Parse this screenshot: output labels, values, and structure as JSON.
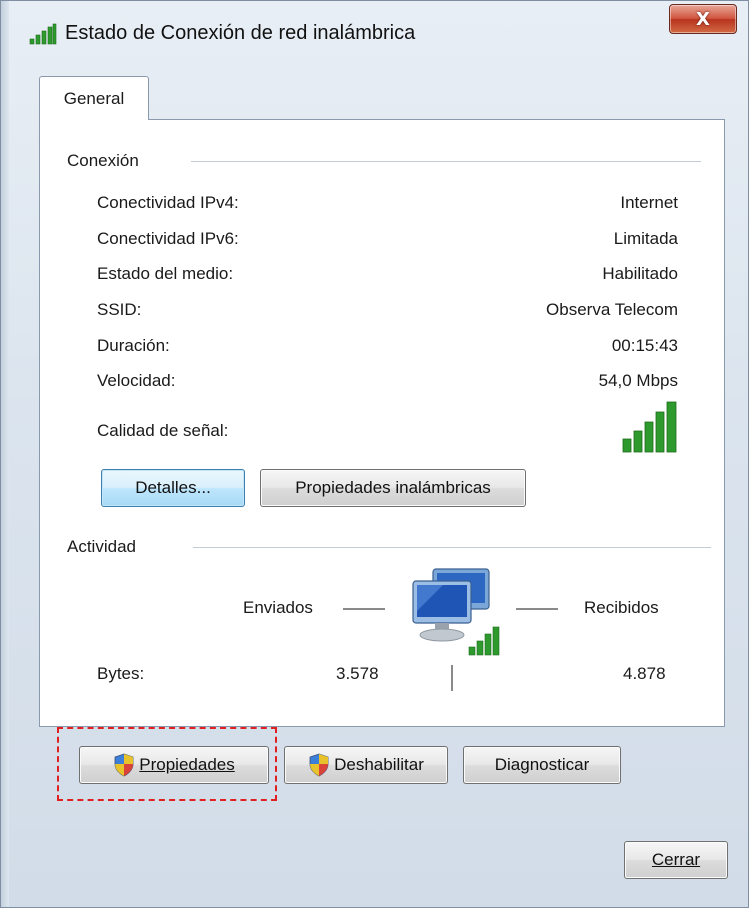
{
  "window": {
    "title": "Estado de Conexión de red inalámbrica",
    "close_label": "X"
  },
  "tabs": [
    {
      "label": "General"
    }
  ],
  "connection": {
    "section_title": "Conexión",
    "rows": [
      {
        "label": "Conectividad IPv4:",
        "value": "Internet"
      },
      {
        "label": "Conectividad IPv6:",
        "value": "Limitada"
      },
      {
        "label": "Estado del medio:",
        "value": "Habilitado"
      },
      {
        "label": "SSID:",
        "value": "Observa Telecom"
      },
      {
        "label": "Duración:",
        "value": "00:15:43"
      },
      {
        "label": "Velocidad:",
        "value": "54,0 Mbps"
      }
    ],
    "signal_label": "Calidad de señal:",
    "signal_icon": "signal-bars-icon",
    "buttons": {
      "details": "Detalles...",
      "wireless_properties": "Propiedades inalámbricas"
    }
  },
  "activity": {
    "section_title": "Actividad",
    "sent_label": "Enviados",
    "received_label": "Recibidos",
    "bytes_label": "Bytes:",
    "bytes_sent": "3.578",
    "bytes_received": "4.878",
    "icon": "network-computers-icon"
  },
  "actions": {
    "properties": "Propiedades",
    "disable": "Deshabilitar",
    "diagnose": "Diagnosticar",
    "close": "Cerrar"
  },
  "colors": {
    "signal_green": "#2e9a2e",
    "highlight_border": "#e02020",
    "close_button": "#c8452e",
    "focused_button": "#bee6fd"
  }
}
